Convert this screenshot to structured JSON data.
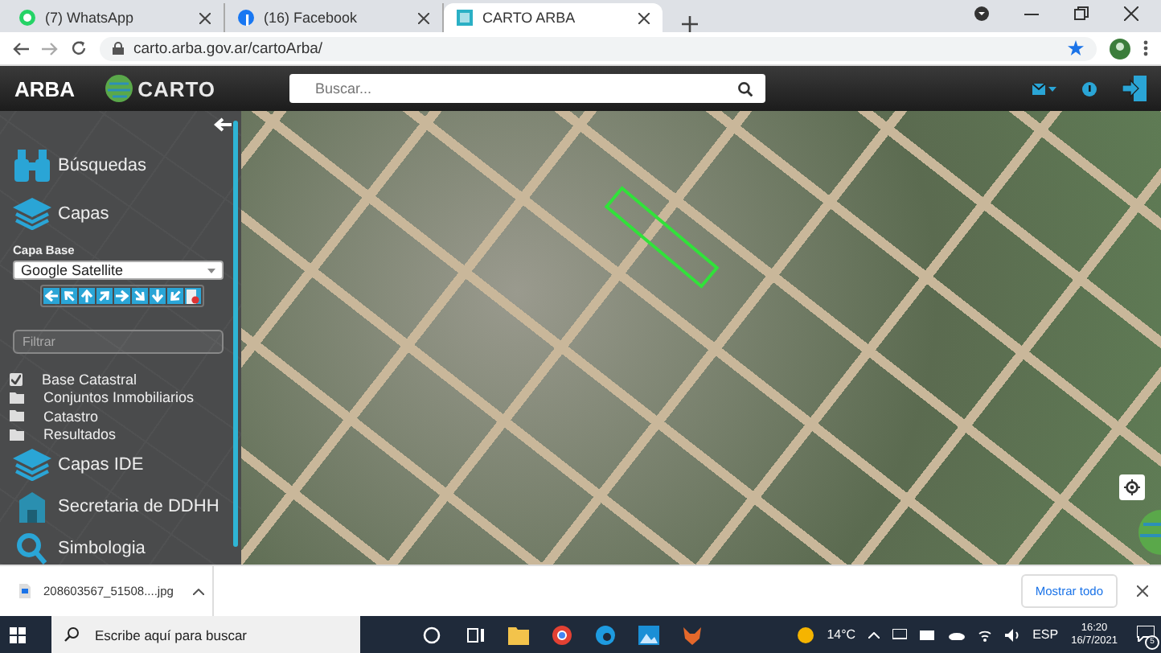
{
  "browser": {
    "tabs": [
      {
        "title": "(7) WhatsApp",
        "selected": false
      },
      {
        "title": "(16) Facebook",
        "selected": false
      },
      {
        "title": "CARTO ARBA",
        "selected": true
      }
    ],
    "url": "carto.arba.gov.ar/cartoArba/"
  },
  "header": {
    "logo": "ARBA",
    "brand": "CARTO",
    "search": {
      "placeholder": "Buscar..."
    }
  },
  "sidebar": {
    "sections": [
      {
        "label": "Búsquedas"
      },
      {
        "label": "Capas"
      }
    ],
    "base_layer": {
      "label": "Capa Base",
      "value": "Google Satellite"
    },
    "filter": {
      "placeholder": "Filtrar"
    },
    "layers": [
      {
        "label": "Base Catastral",
        "kind": "checkbox",
        "checked": true
      },
      {
        "label": "Conjuntos Inmobiliarios",
        "kind": "folder"
      },
      {
        "label": "Catastro",
        "kind": "folder"
      },
      {
        "label": "Resultados",
        "kind": "folder"
      }
    ],
    "more_sections": [
      {
        "label": "Capas IDE"
      },
      {
        "label": "Secretaria de DDHH"
      },
      {
        "label": "Simbologia"
      }
    ]
  },
  "download": {
    "file": "208603567_51508....jpg",
    "button": "Mostrar todo"
  },
  "taskbar": {
    "search": {
      "placeholder": "Escribe aquí para buscar"
    },
    "temperature": "14°C",
    "language": "ESP",
    "time": "16:20",
    "date": "16/7/2021",
    "notifications": "5"
  }
}
